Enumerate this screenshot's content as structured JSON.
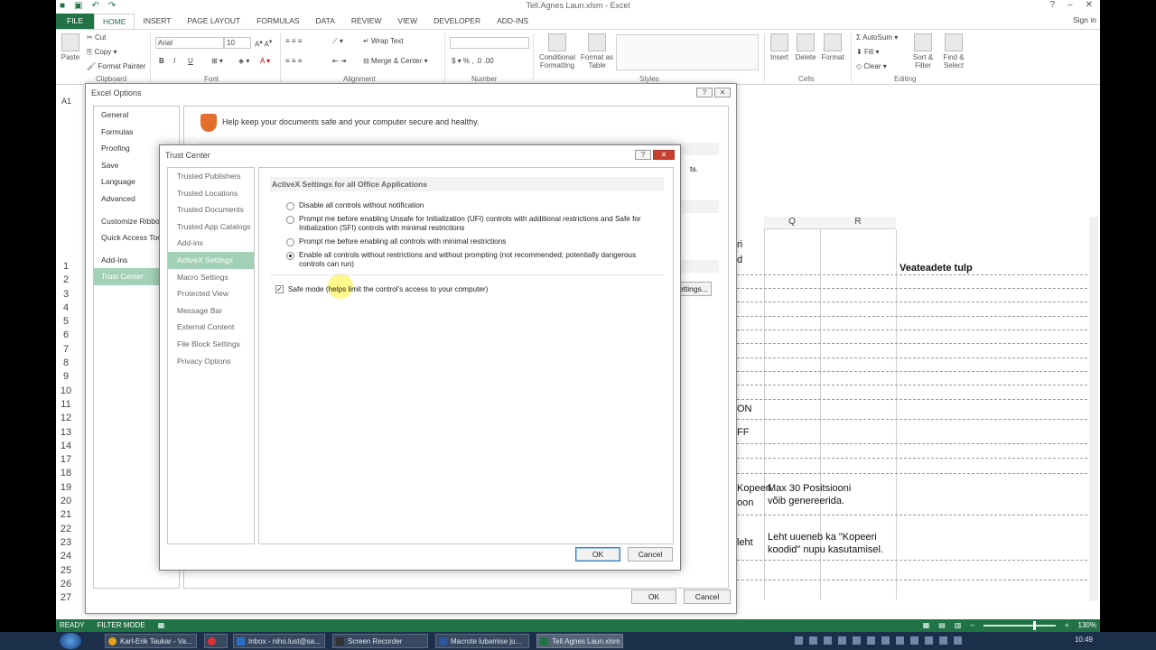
{
  "window": {
    "title": "Tell.Agnes Laun.xlsm - Excel",
    "sign_in": "Sign in"
  },
  "ribbon": {
    "tabs": [
      "FILE",
      "HOME",
      "INSERT",
      "PAGE LAYOUT",
      "FORMULAS",
      "DATA",
      "REVIEW",
      "VIEW",
      "DEVELOPER",
      "ADD-INS"
    ],
    "active_tab": "HOME",
    "clipboard": {
      "paste": "Paste",
      "cut": "Cut",
      "copy": "Copy",
      "format_painter": "Format Painter",
      "label": "Clipboard"
    },
    "font": {
      "name": "Arial",
      "size": "10",
      "label": "Font"
    },
    "alignment": {
      "wrap_text": "Wrap Text",
      "merge_center": "Merge & Center",
      "label": "Alignment"
    },
    "number": {
      "label": "Number"
    },
    "styles": {
      "conditional": "Conditional Formatting",
      "format_table": "Format as Table",
      "label": "Styles"
    },
    "cells": {
      "insert": "Insert",
      "delete": "Delete",
      "format": "Format",
      "label": "Cells"
    },
    "editing": {
      "autosum": "AutoSum",
      "fill": "Fill",
      "clear": "Clear",
      "sort_filter": "Sort & Filter",
      "find_select": "Find & Select",
      "label": "Editing"
    }
  },
  "name_box": "A1",
  "sheet": {
    "columns": [
      "Q",
      "R"
    ],
    "row_numbers": [
      "1",
      "2",
      "3",
      "4",
      "5",
      "6",
      "7",
      "8",
      "9",
      "10",
      "11",
      "12",
      "13",
      "14",
      "17",
      "18",
      "19",
      "20",
      "21",
      "22",
      "23",
      "24",
      "25",
      "26",
      "27"
    ],
    "cells": {
      "veateadete": "Veateadete tulp",
      "ri": "ri",
      "d": "d",
      "on": "ON",
      "off": "FF",
      "kopeeri": "Kopeeri",
      "oon": "oon",
      "max30_a": "Max 30 Positsiooni",
      "max30_b": "võib genereerida.",
      "leht": "leht",
      "leht_a": "Leht uueneb ka \"Kopeeri",
      "leht_b": "koodid\" nupu kasutamisel."
    }
  },
  "status": {
    "ready": "READY",
    "filter_mode": "FILTER MODE",
    "zoom": "130%"
  },
  "excel_options": {
    "title": "Excel Options",
    "nav": [
      "General",
      "Formulas",
      "Proofing",
      "Save",
      "Language",
      "Advanced",
      "Customize Ribbon",
      "Quick Access Toolbar",
      "Add-Ins",
      "Trust Center"
    ],
    "selected": "Trust Center",
    "headline": "Help keep your documents safe and your computer secure and healthy.",
    "settings_btn": "Settings...",
    "ok": "OK",
    "cancel": "Cancel",
    "partial": "ts."
  },
  "trust_center": {
    "title": "Trust Center",
    "help": "?",
    "nav": [
      "Trusted Publishers",
      "Trusted Locations",
      "Trusted Documents",
      "Trusted App Catalogs",
      "Add-ins",
      "ActiveX Settings",
      "Macro Settings",
      "Protected View",
      "Message Bar",
      "External Content",
      "File Block Settings",
      "Privacy Options"
    ],
    "selected": "ActiveX Settings",
    "section_title": "ActiveX Settings for all Office Applications",
    "options": [
      {
        "label": "Disable all controls without notification",
        "checked": false
      },
      {
        "label": "Prompt me before enabling Unsafe for Initialization (UFI) controls with additional restrictions and Safe for Initialization (SFI) controls with minimal restrictions",
        "checked": false
      },
      {
        "label": "Prompt me before enabling all controls with minimal restrictions",
        "checked": false
      },
      {
        "label": "Enable all controls without restrictions and without prompting (not recommended; potentially dangerous controls can run)",
        "checked": true
      }
    ],
    "safe_mode": "Safe mode (helps limit the control's access to your computer)",
    "safe_mode_checked": true,
    "ok": "OK",
    "cancel": "Cancel"
  },
  "taskbar": {
    "items": [
      "Karl-Erik Taukar - Va...",
      "Inbox - niho.lust@sa...",
      "Screen Recorder",
      "Macrote lubamise ju...",
      "Tell.Agnes Laun.xlsm"
    ],
    "clock": "10:49"
  },
  "colors": {
    "excel_green": "#217346",
    "selection_green": "#a3d1b7",
    "taskbar": "#1c2f4a"
  }
}
